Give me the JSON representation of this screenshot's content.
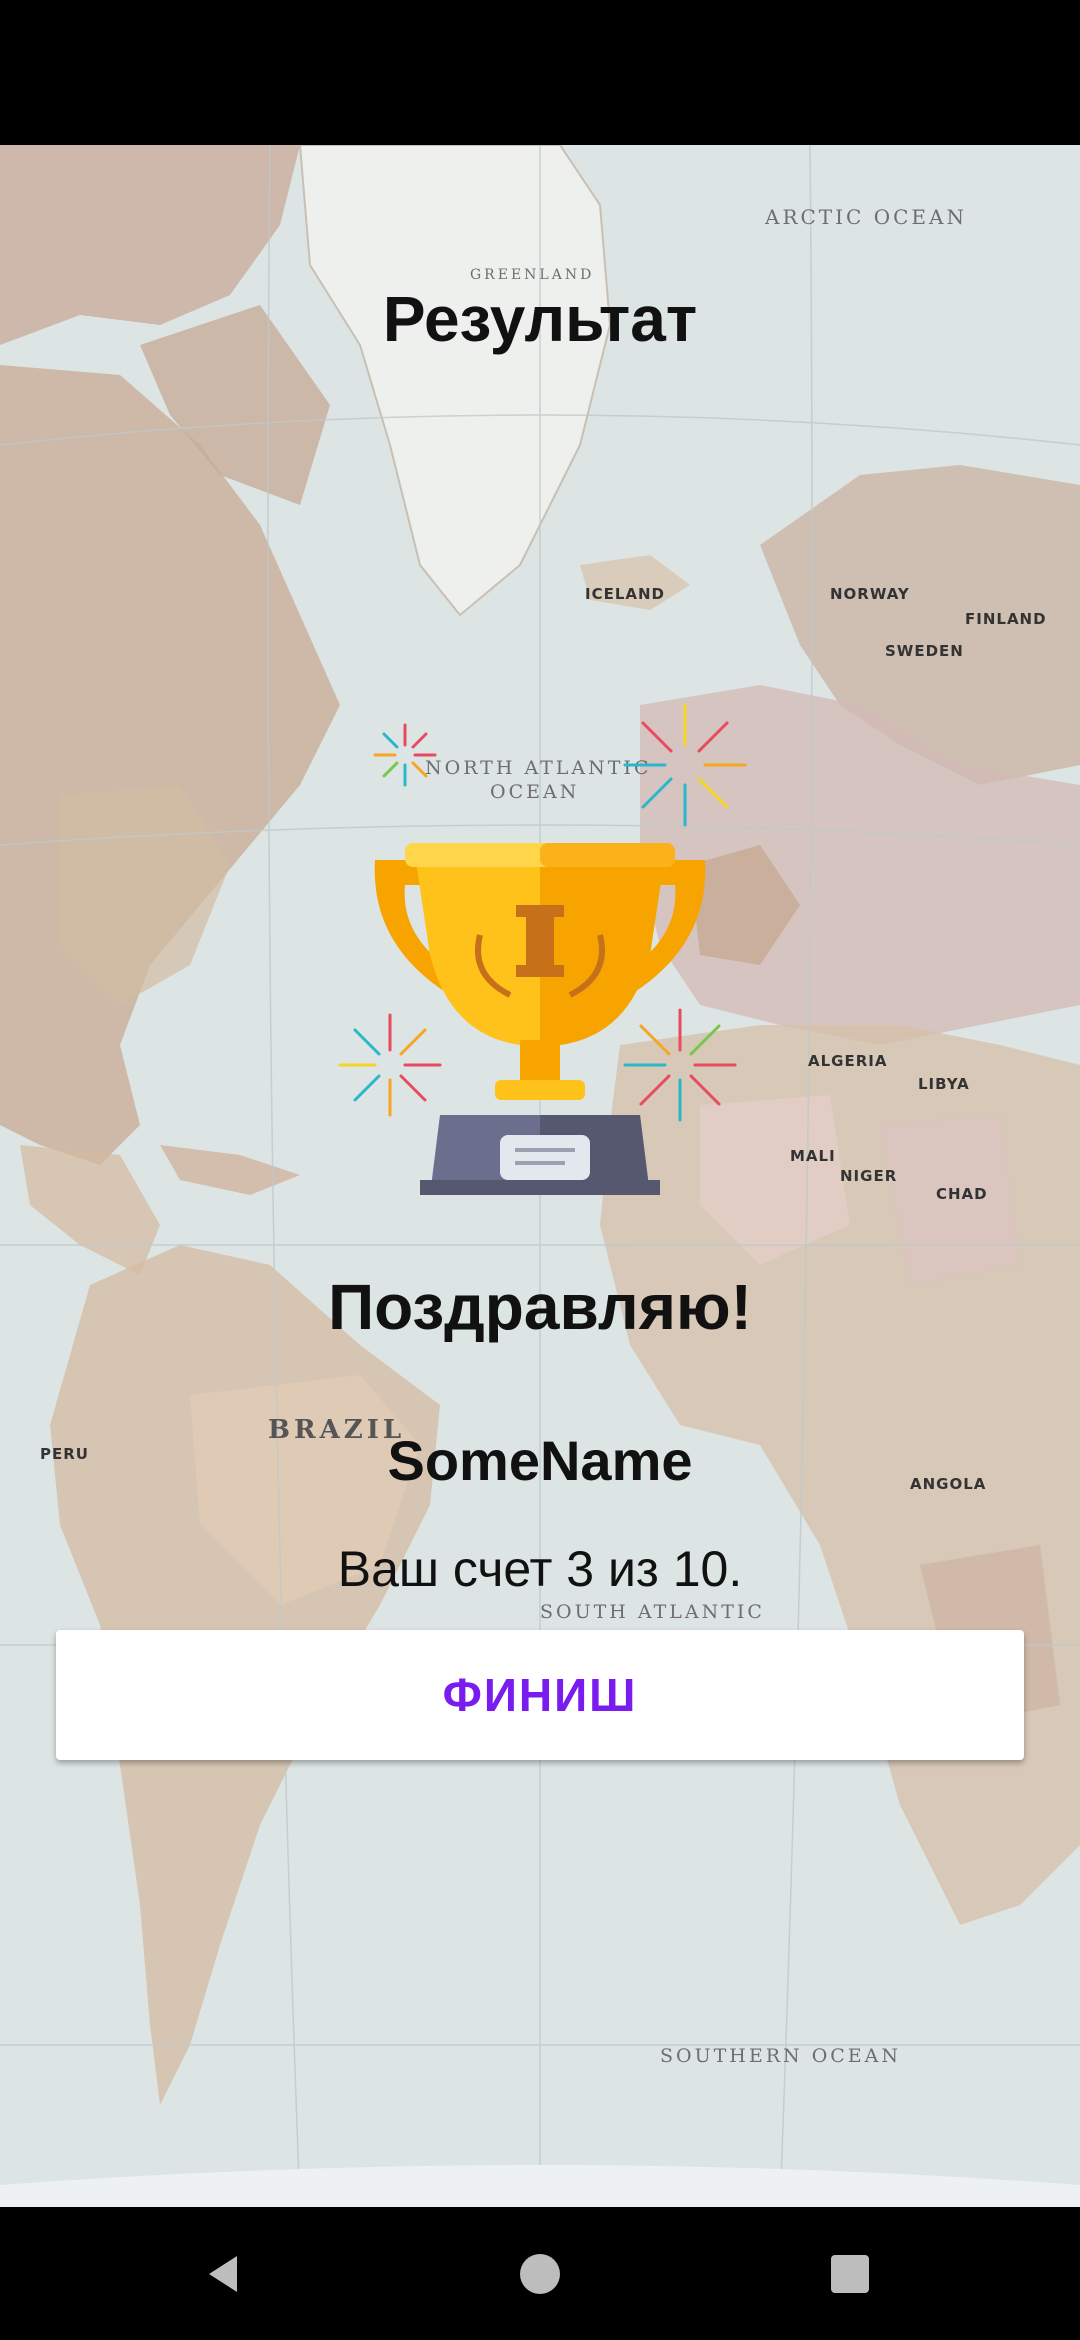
{
  "screen": {
    "title": "Результат",
    "congrats": "Поздравляю!",
    "player_name": "SomeName",
    "score_text": "Ваш счет 3 из 10.",
    "finish_label": "ФИНИШ"
  },
  "map_labels": {
    "arctic": "ARCTIC OCEAN",
    "north_atlantic_1": "NORTH ATLANTIC",
    "north_atlantic_2": "OCEAN",
    "south_atlantic": "SOUTH ATLANTIC",
    "southern": "SOUTHERN OCEAN",
    "brazil": "BRAZIL",
    "algeria": "ALGERIA",
    "libya": "LIBYA",
    "mali": "MALI",
    "niger": "NIGER",
    "chad": "CHAD",
    "angola": "ANGOLA",
    "peru": "PERU",
    "iceland": "ICELAND",
    "greenland": "GREENLAND",
    "norway": "NORWAY",
    "finland": "FINLAND",
    "sweden": "SWEDEN"
  },
  "icons": {
    "trophy": "trophy-icon",
    "back": "back-icon",
    "home": "home-icon",
    "recents": "recents-icon"
  },
  "colors": {
    "accent": "#7a1cf0",
    "trophy_gold": "#ffc21a",
    "trophy_orange": "#f7a400",
    "base": "#6b6e8c"
  }
}
